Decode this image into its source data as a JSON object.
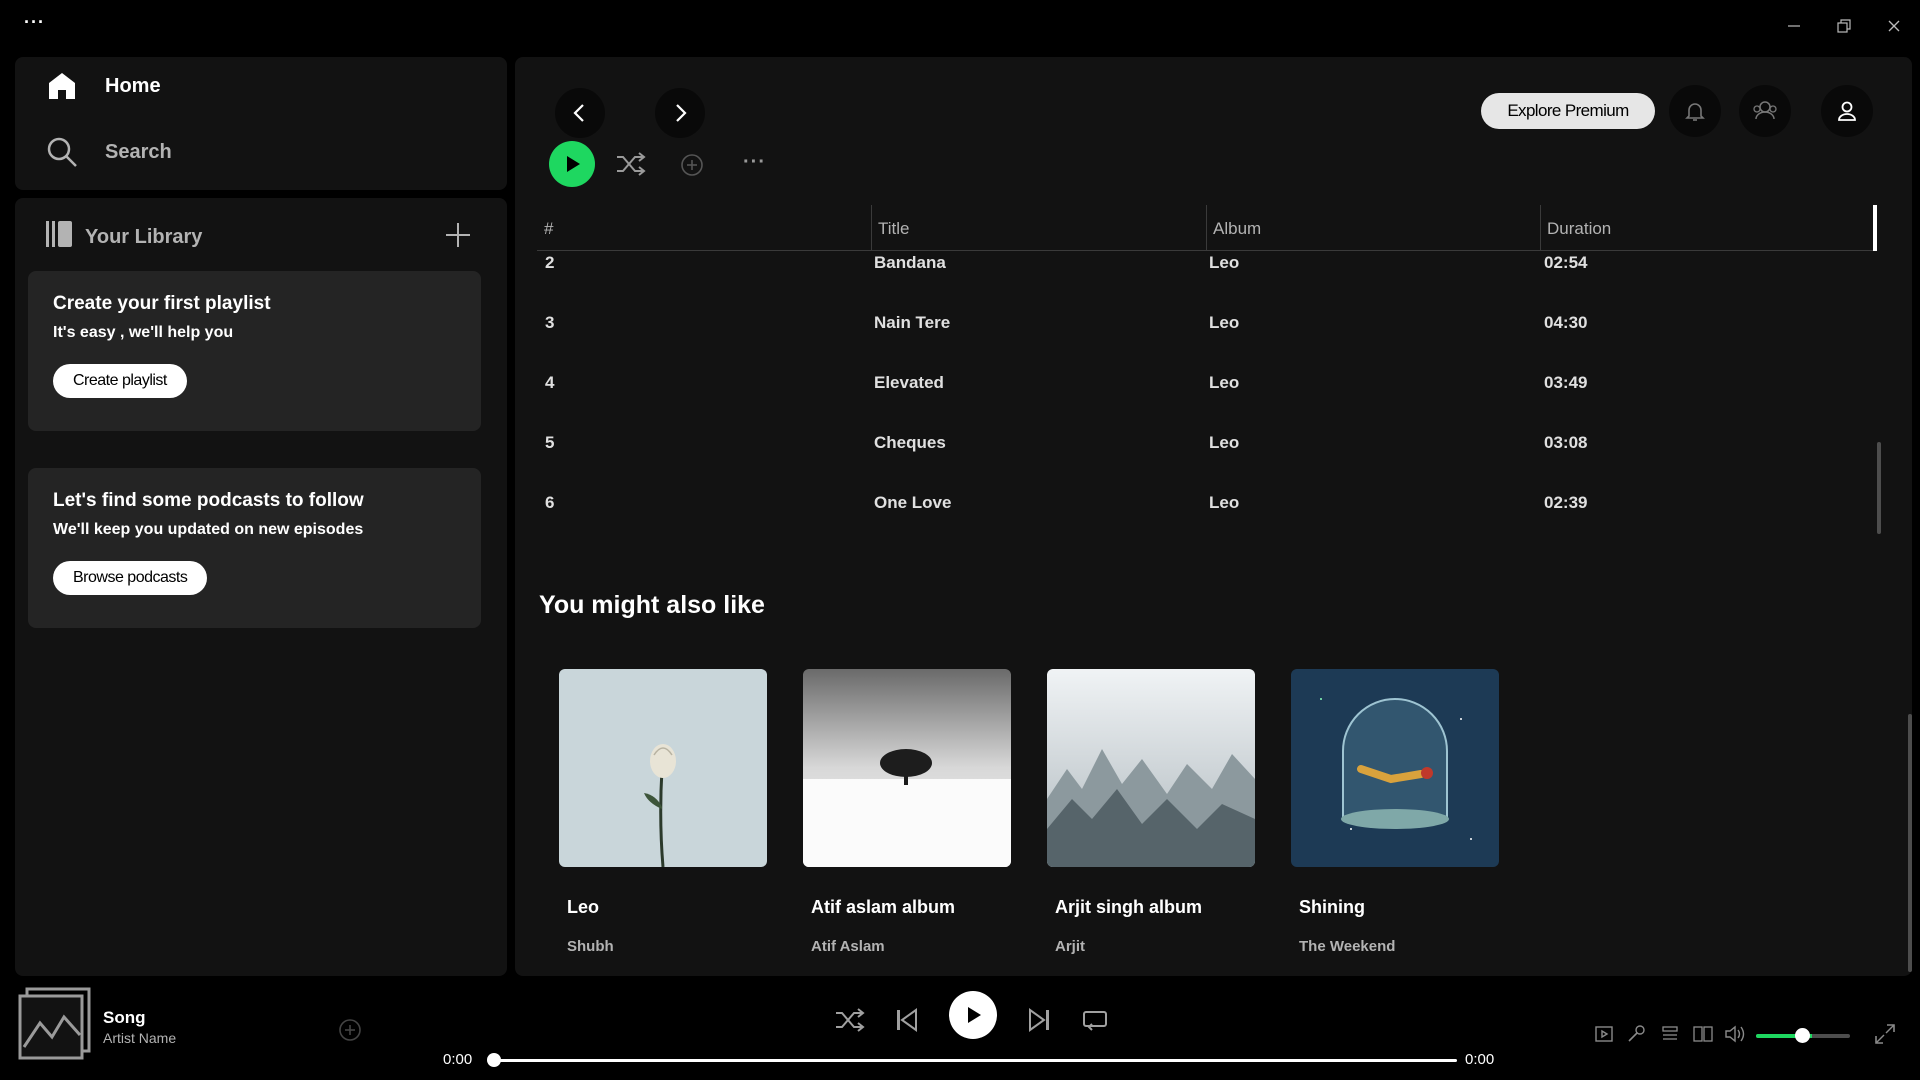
{
  "window": {
    "menu_dots": "···"
  },
  "nav": {
    "home_label": "Home",
    "search_label": "Search"
  },
  "library": {
    "title": "Your Library",
    "promos": [
      {
        "title": "Create your first playlist",
        "subtitle": "It's easy , we'll help you",
        "button": "Create playlist"
      },
      {
        "title": "Let's find some podcasts to follow",
        "subtitle": "We'll keep you updated on new episodes",
        "button": "Browse podcasts"
      }
    ]
  },
  "header": {
    "premium_label": "Explore Premium",
    "more_dots": "···"
  },
  "table": {
    "headers": [
      "#",
      "Title",
      "Album",
      "Duration"
    ],
    "rows": [
      {
        "num": "2",
        "title": "Bandana",
        "album": "Leo",
        "duration": "02:54"
      },
      {
        "num": "3",
        "title": "Nain Tere",
        "album": "Leo",
        "duration": "04:30"
      },
      {
        "num": "4",
        "title": "Elevated",
        "album": "Leo",
        "duration": "03:49"
      },
      {
        "num": "5",
        "title": "Cheques",
        "album": "Leo",
        "duration": "03:08"
      },
      {
        "num": "6",
        "title": "One Love",
        "album": "Leo",
        "duration": "02:39"
      }
    ]
  },
  "recommend": {
    "title": "You might also like",
    "cards": [
      {
        "name": "Leo",
        "artist": "Shubh"
      },
      {
        "name": "Atif aslam album",
        "artist": "Atif Aslam"
      },
      {
        "name": "Arjit singh album",
        "artist": "Arjit"
      },
      {
        "name": "Shining",
        "artist": "The Weekend"
      }
    ]
  },
  "player": {
    "song": "Song",
    "artist": "Artist Name",
    "time_current": "0:00",
    "time_total": "0:00",
    "progress": 0,
    "volume": 0.6
  },
  "colors": {
    "accent": "#1ed760",
    "panel": "#121212",
    "card": "#242424"
  }
}
